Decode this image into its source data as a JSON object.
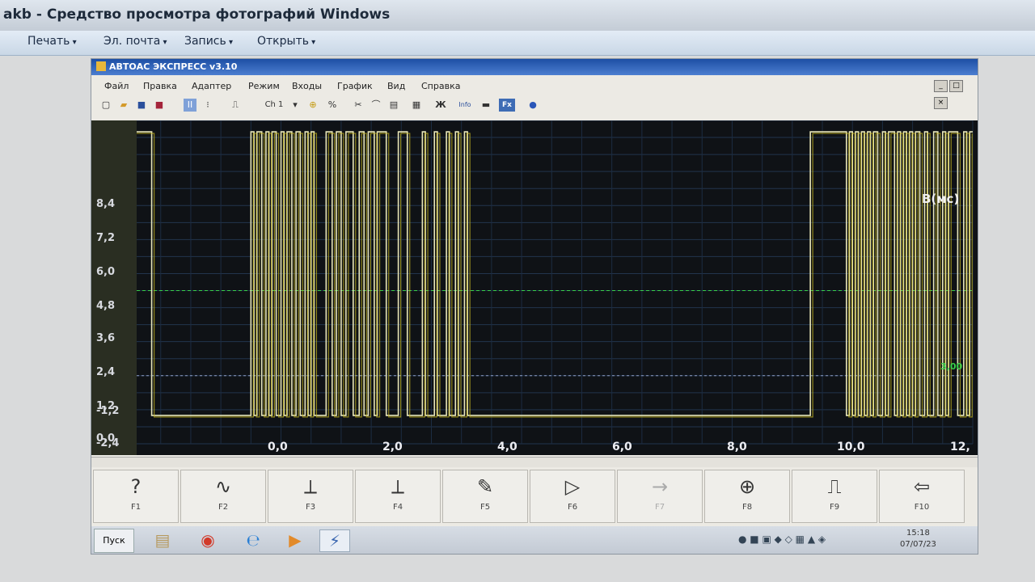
{
  "photo_viewer": {
    "title": "akb - Средство просмотра фотографий Windows",
    "menu": [
      {
        "label": "Печать"
      },
      {
        "label": "Эл. почта"
      },
      {
        "label": "Запись"
      },
      {
        "label": "Открыть"
      }
    ]
  },
  "app": {
    "title": "АВТОАС ЭКСПРЕСС v3.10",
    "menu": [
      "Файл",
      "Правка",
      "Адаптер",
      "Режим",
      "Входы",
      "График",
      "Вид",
      "Справка"
    ],
    "toolbar": {
      "channel": "Ch 1",
      "percent": "%",
      "bold": "Ж",
      "info": "Info",
      "fx": "Fx"
    }
  },
  "chart_data": {
    "type": "line",
    "unit_label": "B(мс)",
    "x_ticks": [
      "0,0",
      "2,0",
      "4,0",
      "6,0",
      "8,0",
      "10,0",
      "12,"
    ],
    "y_ticks": [
      "8,4",
      "7,2",
      "6,0",
      "4,8",
      "3,6",
      "2,4",
      "1,2",
      "0,0",
      "-1,2",
      "-2,4"
    ],
    "xlim": [
      -1.9,
      12.0
    ],
    "ylim": [
      -2.4,
      9.0
    ],
    "threshold": {
      "label": "3,00",
      "value": 3.0,
      "color": "#39d04a"
    },
    "series_color": "#e8e6b8",
    "high": 8.6,
    "low": -1.4,
    "transitions": [
      -1.65,
      0.0,
      0.05,
      0.1,
      0.18,
      0.25,
      0.3,
      0.35,
      0.42,
      0.5,
      0.55,
      0.6,
      0.68,
      0.75,
      0.82,
      0.9,
      0.95,
      1.0,
      1.05,
      1.25,
      1.35,
      1.42,
      1.5,
      1.58,
      1.7,
      1.8,
      1.88,
      1.95,
      2.05,
      2.1,
      2.25,
      2.45,
      2.6,
      2.85,
      2.9,
      3.05,
      3.1,
      3.25,
      3.3,
      3.4,
      3.45,
      3.55,
      3.6,
      9.3,
      9.9,
      9.95,
      10.0,
      10.05,
      10.1,
      10.15,
      10.2,
      10.25,
      10.3,
      10.35,
      10.42,
      10.5,
      10.55,
      10.6,
      10.7,
      10.75,
      10.8,
      10.85,
      10.9,
      10.95,
      11.0,
      11.05,
      11.12,
      11.2,
      11.25,
      11.35,
      11.42,
      11.5,
      11.55,
      11.6,
      11.75,
      11.85,
      11.9,
      11.95
    ],
    "grid": true,
    "background": "#0f1216"
  },
  "function_keys": [
    {
      "label": "F1",
      "glyph": "?"
    },
    {
      "label": "F2",
      "glyph": "∿"
    },
    {
      "label": "F3",
      "glyph": "⟂"
    },
    {
      "label": "F4",
      "glyph": "⟂"
    },
    {
      "label": "F5",
      "glyph": "✎"
    },
    {
      "label": "F6",
      "glyph": "▷"
    },
    {
      "label": "F7",
      "glyph": "→"
    },
    {
      "label": "F8",
      "glyph": "⊕"
    },
    {
      "label": "F9",
      "glyph": "⎍"
    },
    {
      "label": "F10",
      "glyph": "⇦"
    }
  ],
  "taskbar": {
    "start": "Пуск",
    "time": "15:18",
    "date": "07/07/23"
  }
}
